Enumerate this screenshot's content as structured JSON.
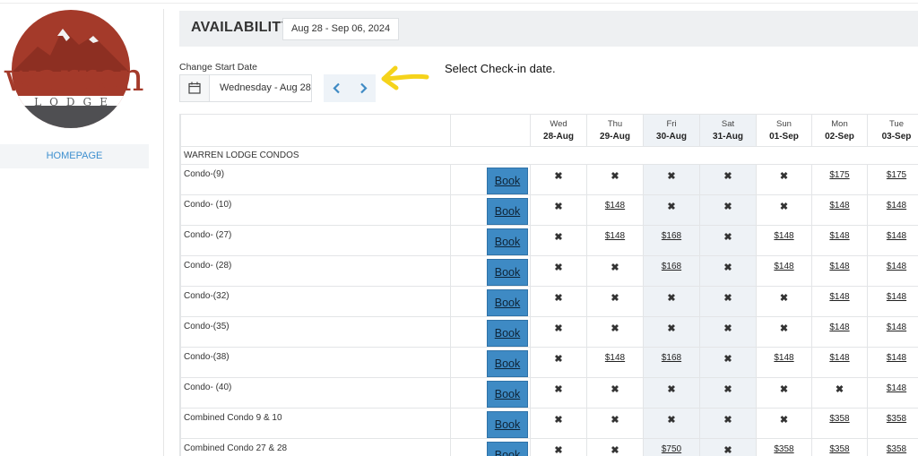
{
  "brand": {
    "name": "warren",
    "sub": "LODGE"
  },
  "sidebar": {
    "home_label": "HOMEPAGE"
  },
  "header": {
    "title": "AVAILABILITY",
    "date_range": "Aug 28 - Sep 06, 2024"
  },
  "date_control": {
    "label": "Change Start Date",
    "value": "Wednesday - Aug 28"
  },
  "hint": {
    "text": "Select Check-in date."
  },
  "table": {
    "days": [
      {
        "dow": "Wed",
        "date": "28-Aug",
        "weekend": false
      },
      {
        "dow": "Thu",
        "date": "29-Aug",
        "weekend": false
      },
      {
        "dow": "Fri",
        "date": "30-Aug",
        "weekend": true
      },
      {
        "dow": "Sat",
        "date": "31-Aug",
        "weekend": true
      },
      {
        "dow": "Sun",
        "date": "01-Sep",
        "weekend": false
      },
      {
        "dow": "Mon",
        "date": "02-Sep",
        "weekend": false
      },
      {
        "dow": "Tue",
        "date": "03-Sep",
        "weekend": false
      }
    ],
    "group": "WARREN LODGE CONDOS",
    "book_label": "Book",
    "unavailable_glyph": "✖",
    "units": [
      {
        "name": "Condo-(9)",
        "rates": [
          "x",
          "x",
          "x",
          "x",
          "x",
          "$175",
          "$175"
        ]
      },
      {
        "name": "Condo- (10)",
        "rates": [
          "x",
          "$148",
          "x",
          "x",
          "x",
          "$148",
          "$148"
        ]
      },
      {
        "name": "Condo- (27)",
        "rates": [
          "x",
          "$148",
          "$168",
          "x",
          "$148",
          "$148",
          "$148"
        ]
      },
      {
        "name": "Condo- (28)",
        "rates": [
          "x",
          "x",
          "$168",
          "x",
          "$148",
          "$148",
          "$148"
        ]
      },
      {
        "name": "Condo-(32)",
        "rates": [
          "x",
          "x",
          "x",
          "x",
          "x",
          "$148",
          "$148"
        ]
      },
      {
        "name": "Condo-(35)",
        "rates": [
          "x",
          "x",
          "x",
          "x",
          "x",
          "$148",
          "$148"
        ]
      },
      {
        "name": "Condo-(38)",
        "rates": [
          "x",
          "$148",
          "$168",
          "x",
          "$148",
          "$148",
          "$148"
        ]
      },
      {
        "name": "Condo- (40)",
        "rates": [
          "x",
          "x",
          "x",
          "x",
          "x",
          "x",
          "$148"
        ]
      },
      {
        "name": "Combined Condo 9 & 10",
        "rates": [
          "x",
          "x",
          "x",
          "x",
          "x",
          "$358",
          "$358"
        ]
      },
      {
        "name": "Combined Condo 27 & 28",
        "rates": [
          "x",
          "x",
          "$750",
          "x",
          "$358",
          "$358",
          "$358"
        ]
      }
    ]
  },
  "colors": {
    "brand_red": "#a43a2a",
    "book_blue": "#3e8ac4",
    "link_blue": "#3d8fcf",
    "hint_arrow": "#f5d31b"
  }
}
